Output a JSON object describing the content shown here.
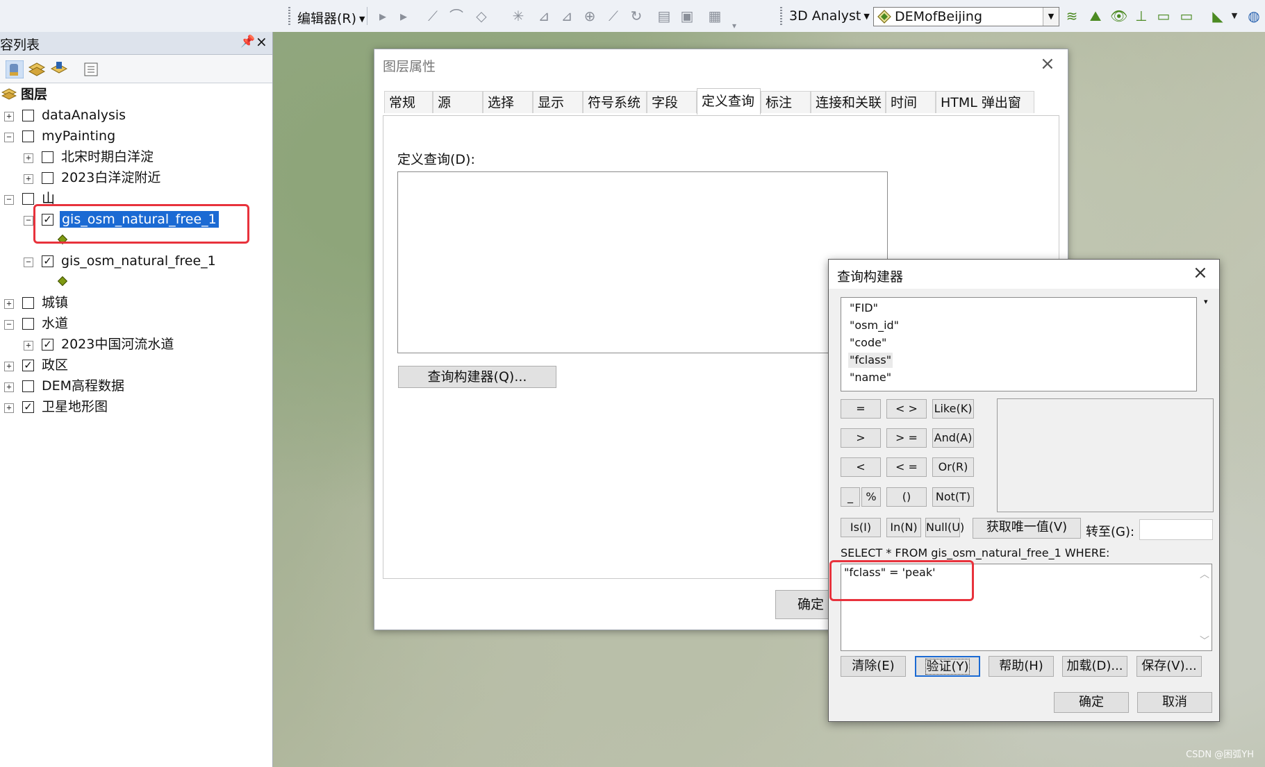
{
  "toolbar": {
    "editor_menu": "编辑器(R)",
    "analyst_menu": "3D Analyst",
    "layer_combo_value": "DEMofBeijing"
  },
  "toc": {
    "title": "容列表",
    "pin": "ꟷ",
    "close": "×",
    "items": [
      {
        "label": "图层"
      },
      {
        "label": "dataAnalysis"
      },
      {
        "label": "myPainting"
      },
      {
        "label": "北宋时期白洋淀"
      },
      {
        "label": "2023白洋淀附近"
      },
      {
        "label": "山"
      },
      {
        "label": "gis_osm_natural_free_1"
      },
      {
        "label": "gis_osm_natural_free_1"
      },
      {
        "label": "城镇"
      },
      {
        "label": "水道"
      },
      {
        "label": "2023中国河流水道"
      },
      {
        "label": "政区"
      },
      {
        "label": "DEM高程数据"
      },
      {
        "label": "卫星地形图"
      }
    ]
  },
  "layer_properties": {
    "title": "图层属性",
    "tabs": [
      "常规",
      "源",
      "选择",
      "显示",
      "符号系统",
      "字段",
      "定义查询",
      "标注",
      "连接和关联",
      "时间",
      "HTML 弹出窗口"
    ],
    "active_tab": "定义查询",
    "definition_query_label": "定义查询(D):",
    "query_builder_button": "查询构建器(Q)...",
    "ok_button": "确定"
  },
  "query_builder": {
    "title": "查询构建器",
    "fields": [
      "\"FID\"",
      "\"osm_id\"",
      "\"code\"",
      "\"fclass\"",
      "\"name\""
    ],
    "operators": {
      "eq": "=",
      "ne": "< >",
      "like": "Like(K)",
      "gt": ">",
      "ge": "> =",
      "and": "And(A)",
      "lt": "<",
      "le": "< =",
      "or": "Or(R)",
      "underscore": "_",
      "percent": "%",
      "parens": "()",
      "not": "Not(T)",
      "is": "Is(I)",
      "in": "In(N)",
      "null": "Null(U)",
      "unique_values": "获取唯一值(V)"
    },
    "goto_label": "转至(G):",
    "sql_prefix": "SELECT * FROM gis_osm_natural_free_1 WHERE:",
    "expression": "\"fclass\" = 'peak'",
    "buttons": {
      "clear": "清除(E)",
      "verify": "验证(Y)",
      "help": "帮助(H)",
      "load": "加载(D)...",
      "save": "保存(V)...",
      "ok": "确定",
      "cancel": "取消"
    }
  },
  "watermark": "CSDN @困弧YH",
  "colors": {
    "accent": "#1b6ad3",
    "annotation": "#e8323c"
  }
}
